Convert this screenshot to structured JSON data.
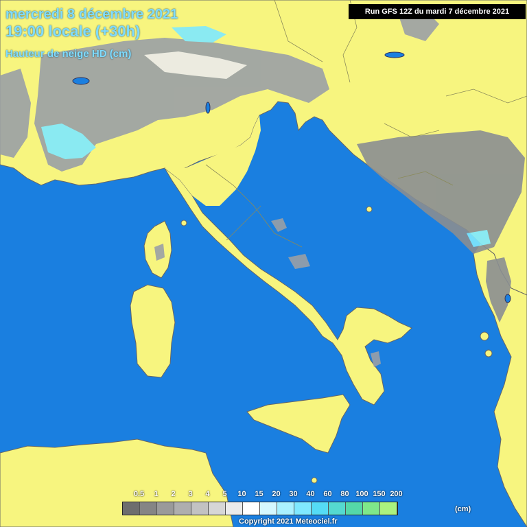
{
  "header": {
    "date": "mercredi 8 décembre 2021",
    "time": "19:00 locale (+30h)",
    "variable": "Hauteur de neige HD (cm)"
  },
  "run_info": "Run GFS 12Z du mardi 7 décembre 2021",
  "legend": {
    "labels": [
      "0.5",
      "1",
      "2",
      "3",
      "4",
      "5",
      "10",
      "15",
      "20",
      "30",
      "40",
      "60",
      "80",
      "100",
      "150",
      "200"
    ],
    "colors": [
      "#6e6e6e",
      "#858585",
      "#9a9a9a",
      "#aeaeae",
      "#c2c2c2",
      "#d6d6d6",
      "#ebebeb",
      "#ffffff",
      "#d5f9ff",
      "#aaf2ff",
      "#7fe9ff",
      "#55dcf5",
      "#55d9d0",
      "#55d8a8",
      "#7fe88a",
      "#aaf27f"
    ],
    "unit": "(cm)"
  },
  "copyright": "Copyright 2021 Meteociel.fr",
  "colors": {
    "sea": "#1a7fe0",
    "land": "#f7f57f",
    "title_text": "#7fdcff",
    "border_lines": "#8a8a5a"
  }
}
